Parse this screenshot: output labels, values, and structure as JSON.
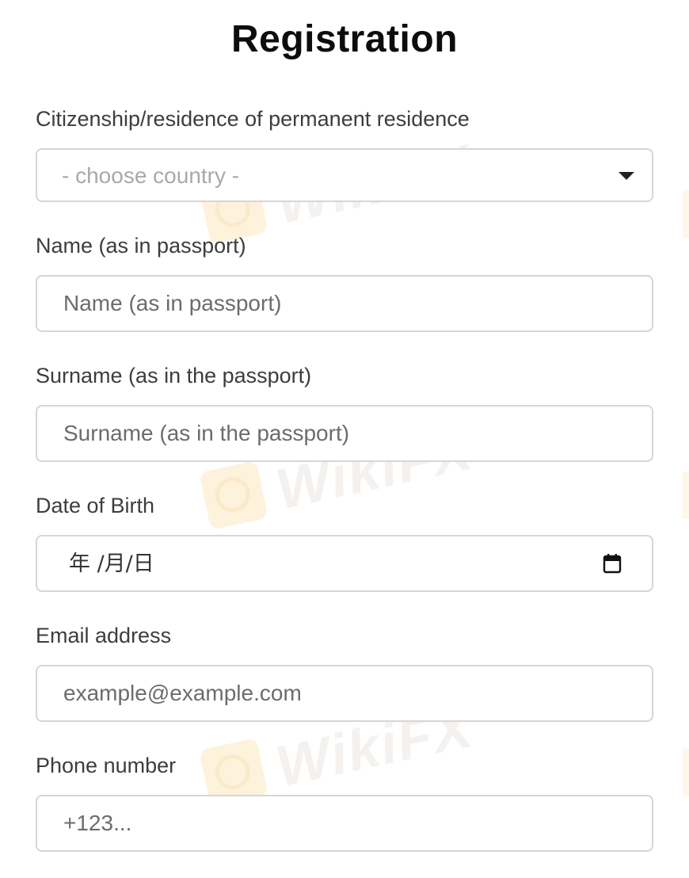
{
  "page": {
    "title": "Registration"
  },
  "form": {
    "citizenship": {
      "label": "Citizenship/residence of permanent residence",
      "placeholder": "- choose country -"
    },
    "name": {
      "label": "Name (as in passport)",
      "placeholder": "Name (as in passport)"
    },
    "surname": {
      "label": "Surname (as in the passport)",
      "placeholder": "Surname (as in the passport)"
    },
    "dob": {
      "label": "Date of Birth",
      "placeholder": "年 /月/日"
    },
    "email": {
      "label": "Email address",
      "placeholder": "example@example.com"
    },
    "phone": {
      "label": "Phone number",
      "placeholder": "+123..."
    }
  },
  "watermark": {
    "text": "WikiFX"
  },
  "icons": {
    "dropdown": "caret-down-icon",
    "calendar": "calendar-icon"
  },
  "colors": {
    "border": "#d6d6d6",
    "title": "#0d0d0d",
    "label": "#3d3d3d",
    "placeholder": "#6c6c6c"
  }
}
